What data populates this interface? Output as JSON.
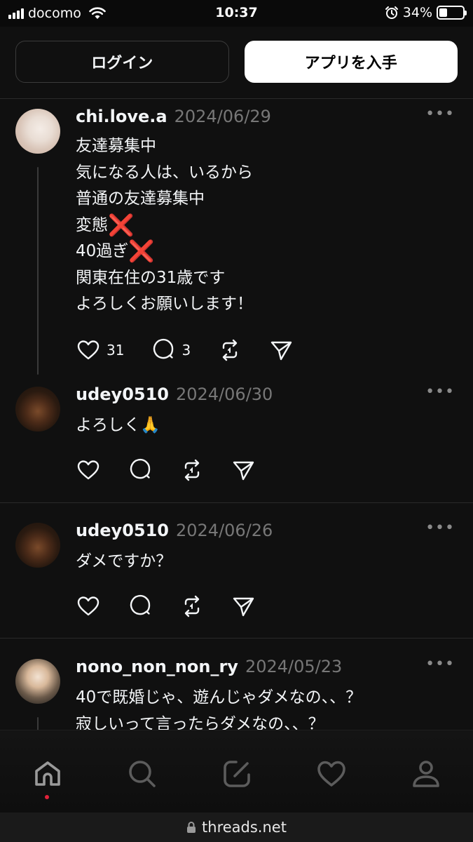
{
  "status_bar": {
    "carrier": "docomo",
    "time": "10:37",
    "battery_percent": "34%",
    "battery_level": 0.34
  },
  "top_actions": {
    "login_label": "ログイン",
    "get_app_label": "アプリを入手"
  },
  "posts": [
    {
      "username": "chi.love.a",
      "date": "2024/06/29",
      "lines": [
        "友達募集中",
        "気になる人は、いるから",
        "普通の友達募集中",
        "変態",
        "40過ぎ",
        "関東在住の31歳です",
        "よろしくお願いします！"
      ],
      "like_count": "31",
      "reply_count": "3",
      "cross_emoji": "❌"
    },
    {
      "username": "udey0510",
      "date": "2024/06/30",
      "text": "よろしく",
      "emoji": "🙏"
    },
    {
      "username": "udey0510",
      "date": "2024/06/26",
      "text": "ダメですか？"
    },
    {
      "username": "nono_non_non_ry",
      "date": "2024/05/23",
      "lines": [
        "40で既婚じゃ、遊んじゃダメなの、、？",
        "寂しいって言ったらダメなの、、？"
      ]
    }
  ],
  "more_label": "•••",
  "url": "threads.net",
  "colors": {
    "background": "#101010",
    "accent_dot": "#e2223a",
    "cross": "#e0142b"
  },
  "icons": [
    "home-icon",
    "search-icon",
    "compose-icon",
    "heart-icon",
    "profile-icon",
    "like-icon",
    "reply-icon",
    "repost-icon",
    "share-icon",
    "lock-icon"
  ]
}
